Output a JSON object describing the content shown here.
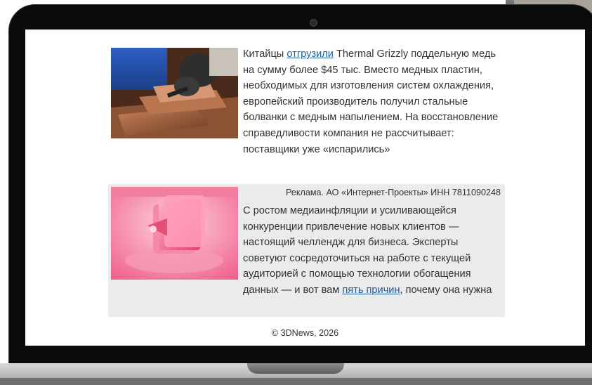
{
  "news": {
    "text_before": "Китайцы ",
    "link_text": "отгрузили",
    "text_after": " Thermal Grizzly поддельную медь на сумму более $45 тыс. Вместо медных пластин, необходимых для изготовления систем охлаждения, европейский производитель получил стальные болванки с медным напылением. На восстановление справедливости компания не рассчитывает: поставщики уже «испарились»"
  },
  "ad": {
    "label": "Реклама. АО «Интернет-Проекты» ИНН 7811090248",
    "text_before": "С ростом медиаинфляции и усиливающейся конкуренции привлечение новых клиентов — настоящий челлендж для бизнеса. Эксперты советуют сосредоточиться на работе с текущей аудиторией с помощью технологии обогащения данных — и вот вам ",
    "link_text": "пять причин",
    "text_after": ", почему она нужна"
  },
  "footer": {
    "copyright": "© 3DNews, 2026"
  },
  "colors": {
    "link": "#1a5fa0",
    "ad_background": "#ebebeb",
    "text": "#333333"
  }
}
